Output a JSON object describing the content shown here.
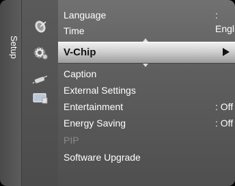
{
  "side_tab": {
    "label": "Setup"
  },
  "icons": [
    "satellite-icon",
    "gear-icon",
    "remote-icon",
    "display-icon"
  ],
  "menu": {
    "items": [
      {
        "label": "Language",
        "value": ": English"
      },
      {
        "label": "Time",
        "value": ""
      },
      {
        "label": "V-Chip",
        "value": ""
      },
      {
        "label": "Caption",
        "value": ""
      },
      {
        "label": "External Settings",
        "value": ""
      },
      {
        "label": "Entertainment",
        "value": ": Off"
      },
      {
        "label": "Energy Saving",
        "value": ": Off"
      },
      {
        "label": "PIP",
        "value": ""
      },
      {
        "label": "Software Upgrade",
        "value": ""
      }
    ],
    "selected_index": 2
  },
  "colors": {
    "selected_text": "#111111",
    "disabled_text": "#8a8a8a",
    "text": "#ffffff"
  }
}
